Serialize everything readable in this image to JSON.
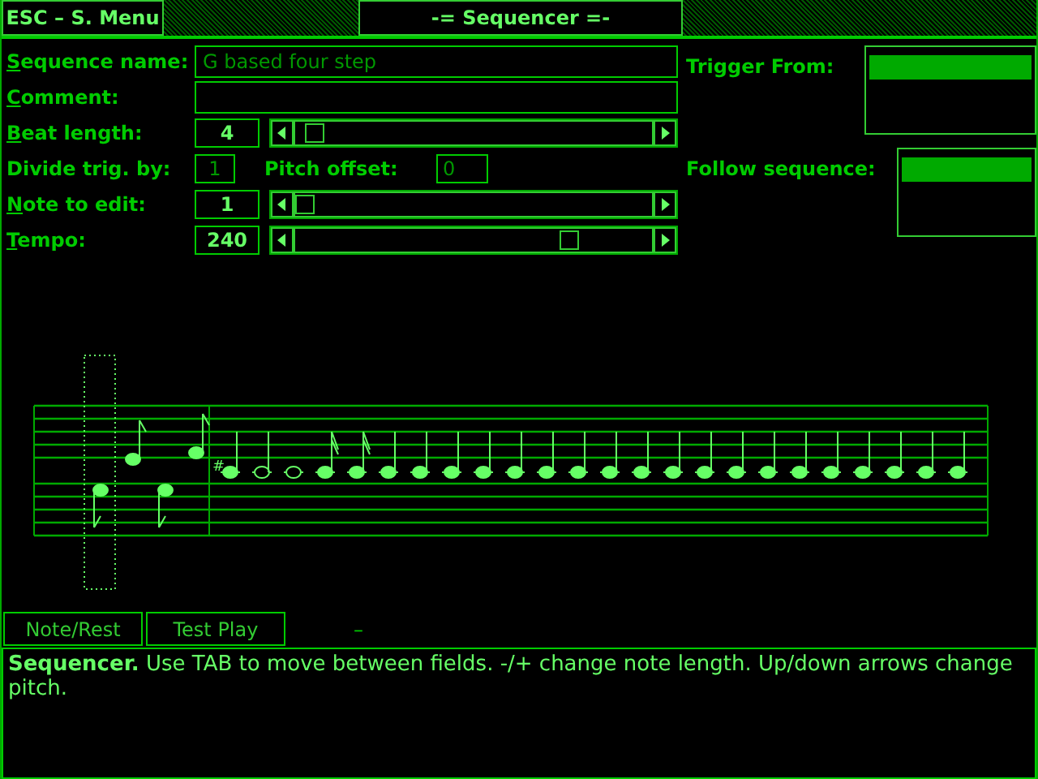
{
  "header": {
    "menu_button": "ESC – S. Menu",
    "title": "-= Sequencer =-"
  },
  "form": [
    {
      "kind": "text",
      "label": "Sequence name:",
      "hotkey_underlined": true,
      "value": "G based four step"
    },
    {
      "kind": "text",
      "label": "Comment:",
      "hotkey_underlined": true
    },
    {
      "kind": "slider",
      "label": "Beat length:",
      "hotkey_underlined": true,
      "value": "4",
      "level": 0.03
    },
    {
      "kind": "pair",
      "label": "Divide trig. by:",
      "value": "1",
      "label_2": "Pitch offset:",
      "value_2": "0"
    },
    {
      "kind": "slider",
      "label": "Note to edit:",
      "hotkey_underlined": true,
      "value": "1",
      "level": 0.0
    },
    {
      "kind": "slider",
      "label": "Tempo:",
      "hotkey_underlined": true,
      "value": "240",
      "level": 0.79
    }
  ],
  "trigger_from": {
    "label": "Trigger From:",
    "items": [
      {
        "selected": true
      }
    ]
  },
  "follow_sequence": {
    "label": "Follow sequence:",
    "items": [
      {
        "selected": true
      }
    ]
  },
  "staff": {
    "accidental": "#"
  },
  "buttons": [
    {
      "label": "Note/Rest"
    },
    {
      "label": "Test Play"
    }
  ],
  "indicator": "–",
  "status": "**Sequencer.** Use TAB to move between fields. -/+ change note length. Up/down arrows change pitch."
}
